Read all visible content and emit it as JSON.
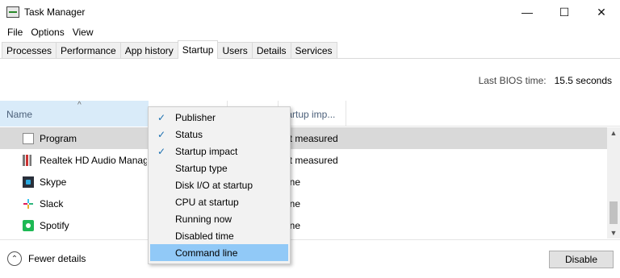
{
  "window": {
    "title": "Task Manager",
    "controls": {
      "minimize": "—",
      "maximize": "☐",
      "close": "✕"
    }
  },
  "menubar": {
    "items": [
      "File",
      "Options",
      "View"
    ]
  },
  "tabs": [
    {
      "label": "Processes"
    },
    {
      "label": "Performance"
    },
    {
      "label": "App history"
    },
    {
      "label": "Startup",
      "active": true
    },
    {
      "label": "Users"
    },
    {
      "label": "Details"
    },
    {
      "label": "Services"
    }
  ],
  "bios": {
    "label": "Last BIOS time:",
    "value": "15.5 seconds"
  },
  "columns": {
    "name": "Name",
    "sort_indicator": "^",
    "impact": "tartup imp..."
  },
  "rows": [
    {
      "name": "Program",
      "impact": "ot measured",
      "icon": "document-icon",
      "selected": true
    },
    {
      "name": "Realtek HD Audio Manager",
      "impact": "ot measured",
      "icon": "realtek-icon"
    },
    {
      "name": "Skype",
      "impact": "one",
      "icon": "skype-icon"
    },
    {
      "name": "Slack",
      "impact": "one",
      "icon": "slack-icon"
    },
    {
      "name": "Spotify",
      "impact": "one",
      "icon": "spotify-icon"
    }
  ],
  "context_menu": {
    "items": [
      {
        "label": "Publisher",
        "checked": true
      },
      {
        "label": "Status",
        "checked": true
      },
      {
        "label": "Startup impact",
        "checked": true
      },
      {
        "label": "Startup type",
        "checked": false
      },
      {
        "label": "Disk I/O at startup",
        "checked": false
      },
      {
        "label": "CPU at startup",
        "checked": false
      },
      {
        "label": "Running now",
        "checked": false
      },
      {
        "label": "Disabled time",
        "checked": false
      },
      {
        "label": "Command line",
        "checked": false,
        "highlighted": true
      }
    ],
    "check_glyph": "✓"
  },
  "footer": {
    "fewer_details": "Fewer details",
    "fewer_glyph": "⌃",
    "disable": "Disable"
  },
  "scrollbar": {
    "up": "▲",
    "down": "▼"
  },
  "colors": {
    "header_highlight": "#d9ebf9",
    "menu_highlight": "#91c9f7",
    "selected_row": "#d9d9d9"
  }
}
